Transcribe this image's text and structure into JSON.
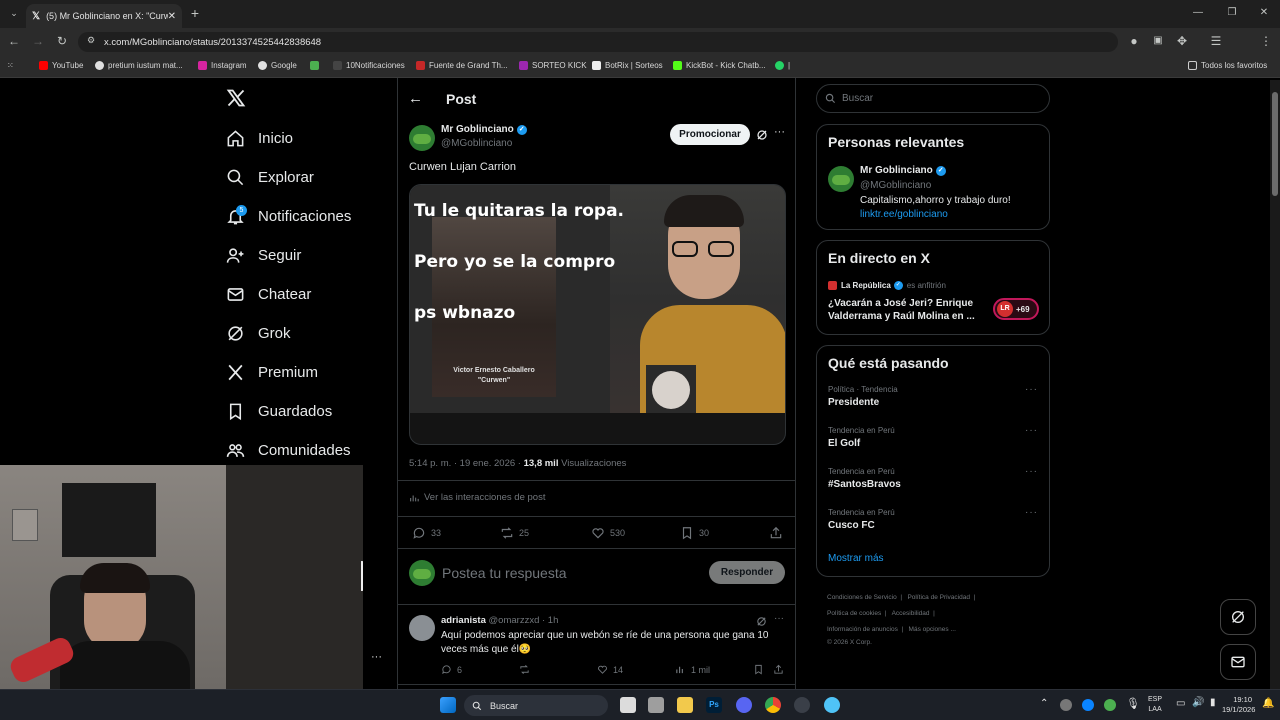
{
  "browser": {
    "tab_title": "(5) Mr Goblinciano en X: \"Curwen",
    "url": "x.com/MGoblinciano/status/2013374525442838648",
    "bookmarks": [
      "YouTube",
      "pretium iustum mat...",
      "Instagram",
      "Google",
      "10Notificaciones",
      "Fuente de Grand Th...",
      "SORTEO KICK",
      "BotRix | Sorteos",
      "KickBot - Kick Chatb...",
      "Todos los favoritos"
    ]
  },
  "nav": {
    "items": [
      "Inicio",
      "Explorar",
      "Notificaciones",
      "Seguir",
      "Chatear",
      "Grok",
      "Premium",
      "Guardados",
      "Comunidades"
    ],
    "notif_badge": "5"
  },
  "post": {
    "header": "Post",
    "author_name": "Mr Goblinciano",
    "author_handle": "@MGoblinciano",
    "promote": "Promocionar",
    "text": "Curwen Lujan Carrion",
    "meme_lines": [
      "Tu le quitaras la ropa.",
      "Pero yo se la compro",
      "ps wbnazo"
    ],
    "meme_caption": [
      "Victor Ernesto Caballero",
      "\"Curwen\""
    ],
    "meta_time": "5:14 p. m. · 19 ene. 2026 · ",
    "views": "13,8 mil",
    "views_label": " Visualizaciones",
    "interactions": "Ver las interacciones de post",
    "replies": "33",
    "reposts": "25",
    "likes": "530",
    "bookmarks": "30",
    "reply_placeholder": "Postea tu respuesta",
    "reply_button": "Responder"
  },
  "reply": {
    "name": "adrianista",
    "handle": "@omarzzxd · 1h",
    "text": "Aquí podemos apreciar que un webón se ríe de una persona que gana 10 veces más que él🥺",
    "replies": "6",
    "likes": "14",
    "views": "1 mil"
  },
  "right": {
    "search_placeholder": "Buscar",
    "relevant_title": "Personas relevantes",
    "rel_name": "Mr Goblinciano",
    "rel_handle": "@MGoblinciano",
    "rel_bio": "Capitalismo,ahorro y trabajo duro!",
    "rel_link": "linktr.ee/goblinciano",
    "live_title": "En directo en X",
    "live_host": "La República",
    "live_role": "es anfitrión",
    "live_text": "¿Vacarán a José Jeri? Enrique Valderrama y Raúl Molina en ...",
    "live_count": "+69",
    "live_logo": "LR",
    "happening_title": "Qué está pasando",
    "trends": [
      {
        "context": "Política · Tendencia",
        "name": "Presidente"
      },
      {
        "context": "Tendencia en Perú",
        "name": "El Golf"
      },
      {
        "context": "Tendencia en Perú",
        "name": "#SantosBravos"
      },
      {
        "context": "Tendencia en Perú",
        "name": "Cusco FC"
      }
    ],
    "show_more": "Mostrar más",
    "footer": [
      "Condiciones de Servicio",
      "Política de Privacidad",
      "Política de cookies",
      "Accesibilidad",
      "Información de anuncios",
      "Más opciones ...",
      "© 2026 X Corp."
    ]
  },
  "taskbar": {
    "search": "Buscar",
    "lang": "ESP",
    "lang2": "LAA",
    "time": "19:10",
    "date": "19/1/2026"
  },
  "colors": {
    "accent": "#1d9bf0",
    "bg": "#000000",
    "border": "#2f3336"
  }
}
